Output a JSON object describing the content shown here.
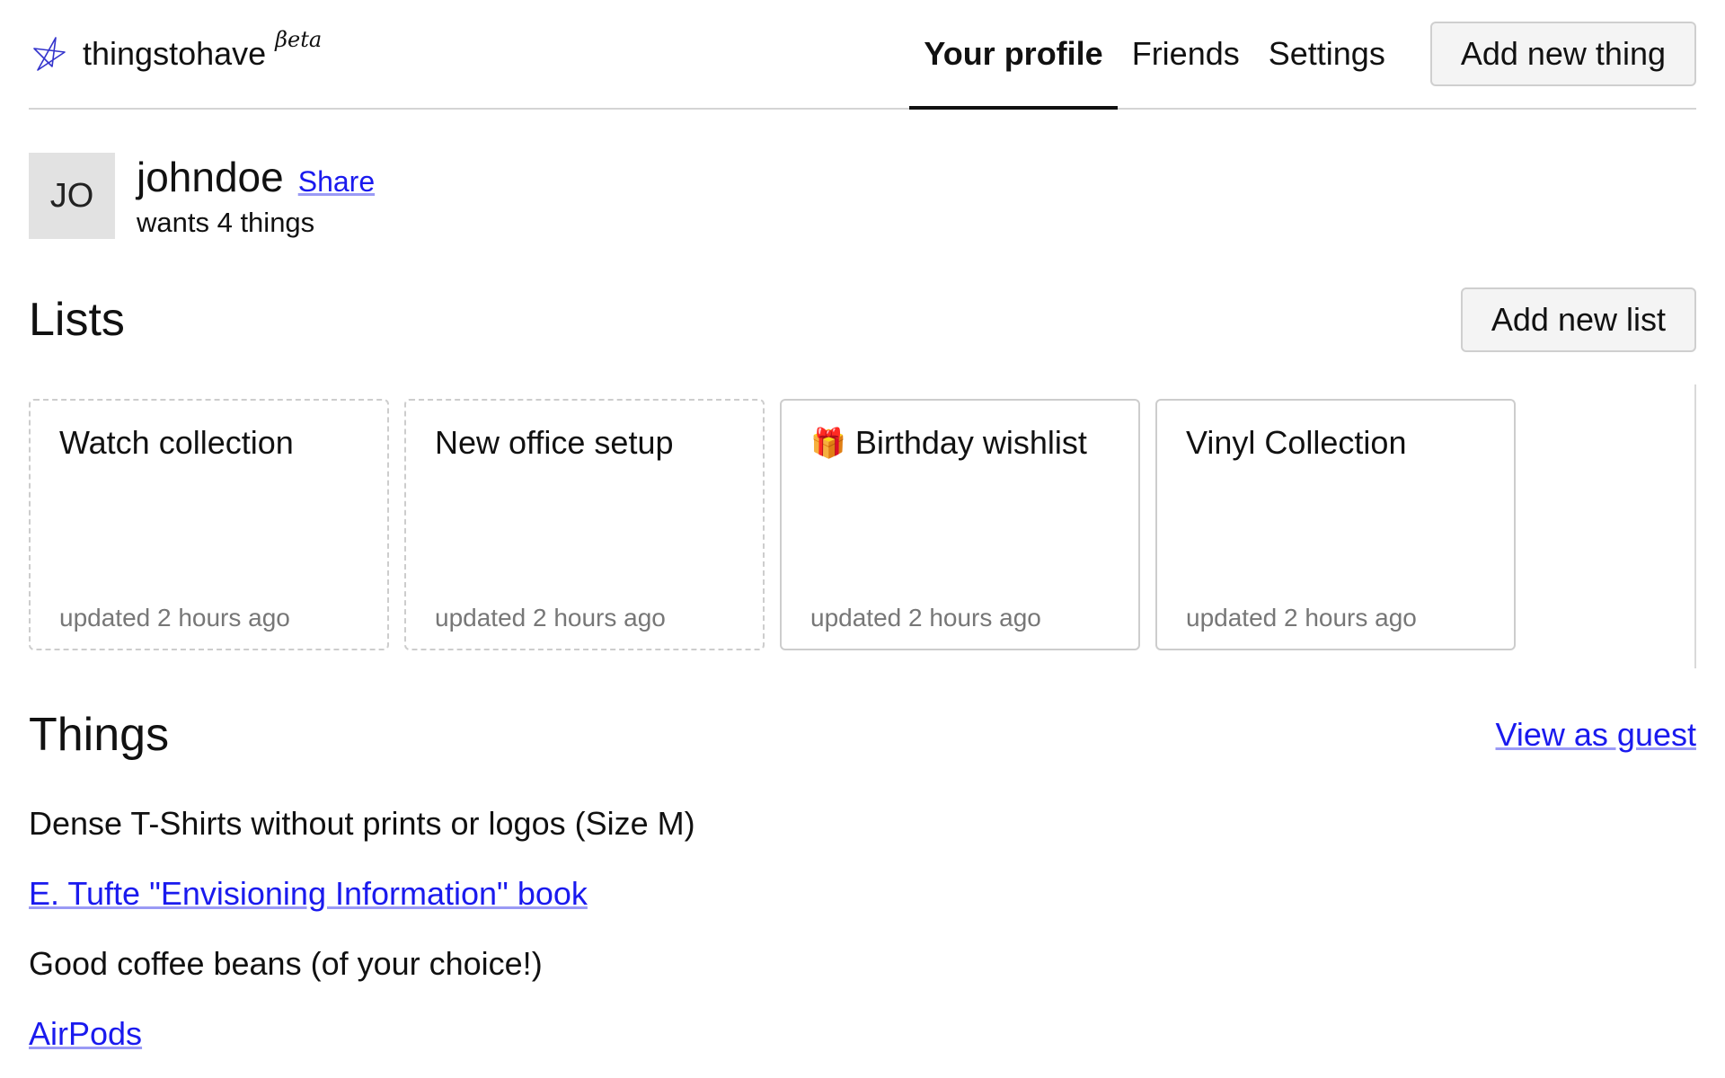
{
  "brand": {
    "name": "thingstohave",
    "badge": "βeta",
    "icon": "star-icon"
  },
  "nav": {
    "items": [
      {
        "label": "Your profile",
        "active": true
      },
      {
        "label": "Friends",
        "active": false
      },
      {
        "label": "Settings",
        "active": false
      }
    ],
    "add_thing_label": "Add new thing"
  },
  "profile": {
    "avatar_initials": "JO",
    "username": "johndoe",
    "share_label": "Share",
    "wants_text": "wants 4 things"
  },
  "lists": {
    "title": "Lists",
    "add_list_label": "Add new list",
    "cards": [
      {
        "emoji": "",
        "title": "Watch collection",
        "updated": "updated 2 hours ago",
        "style": "dashed"
      },
      {
        "emoji": "",
        "title": "New office setup",
        "updated": "updated 2 hours ago",
        "style": "dashed"
      },
      {
        "emoji": "🎁",
        "title": "Birthday wishlist",
        "updated": "updated 2 hours ago",
        "style": "solid"
      },
      {
        "emoji": "",
        "title": "Vinyl Collection",
        "updated": "updated 2 hours ago",
        "style": "solid"
      }
    ]
  },
  "things": {
    "title": "Things",
    "view_as_guest_label": "View as guest",
    "items": [
      {
        "text": "Dense T-Shirts without prints or logos (Size M)",
        "is_link": false
      },
      {
        "text": "E. Tufte \"Envisioning Information\" book",
        "is_link": true
      },
      {
        "text": "Good coffee beans (of your choice!)",
        "is_link": false
      },
      {
        "text": "AirPods",
        "is_link": true
      }
    ]
  },
  "colors": {
    "link": "#1a1aee",
    "border": "#cdcdcd",
    "muted": "#777777"
  }
}
